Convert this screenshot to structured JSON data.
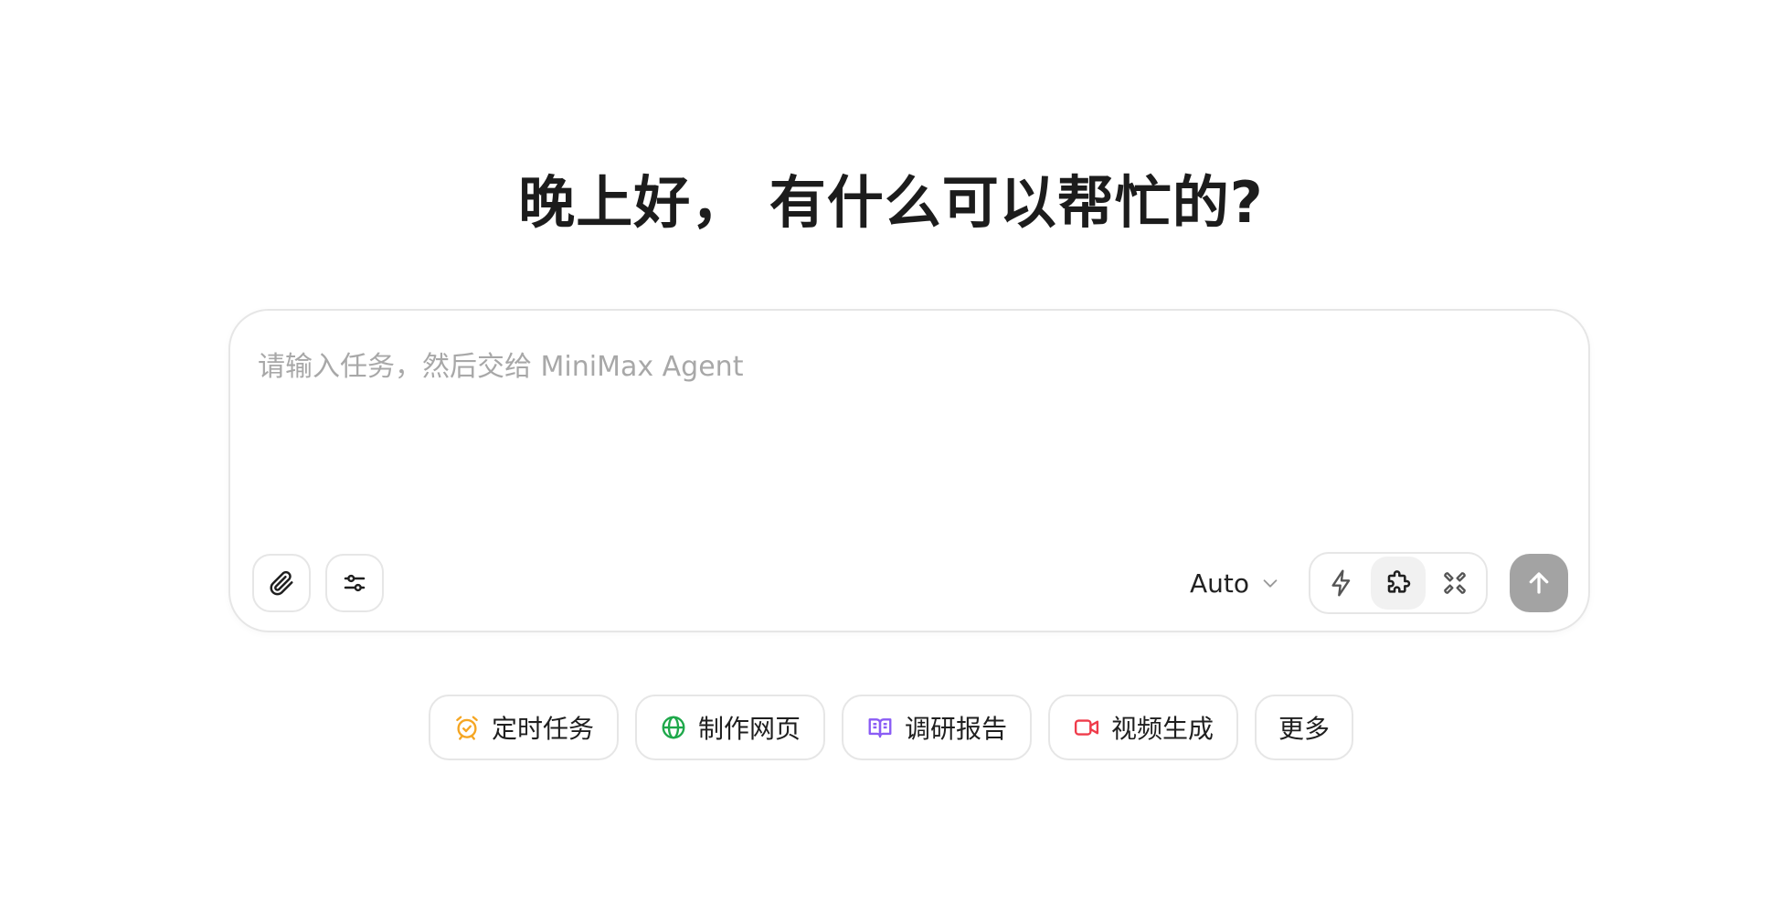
{
  "greeting": "晚上好， 有什么可以帮忙的?",
  "composer": {
    "placeholder": "请输入任务，然后交给 MiniMax Agent",
    "value": ""
  },
  "toolbar": {
    "attach_icon": "paperclip-icon",
    "settings_icon": "sliders-icon",
    "model_label": "Auto",
    "mode_icons": [
      "lightning-icon",
      "puzzle-icon",
      "cross-arrows-icon"
    ],
    "active_mode": "puzzle-icon",
    "send_icon": "arrow-up-icon",
    "send_color": "#a3a3a3"
  },
  "chips": [
    {
      "label": "定时任务",
      "icon": "alarm-clock-icon",
      "color": "#f5a623"
    },
    {
      "label": "制作网页",
      "icon": "globe-icon",
      "color": "#1ea84a"
    },
    {
      "label": "调研报告",
      "icon": "book-icon",
      "color": "#8a5cf5"
    },
    {
      "label": "视频生成",
      "icon": "video-camera-icon",
      "color": "#ef3b4a"
    },
    {
      "label": "更多",
      "icon": "",
      "color": ""
    }
  ]
}
